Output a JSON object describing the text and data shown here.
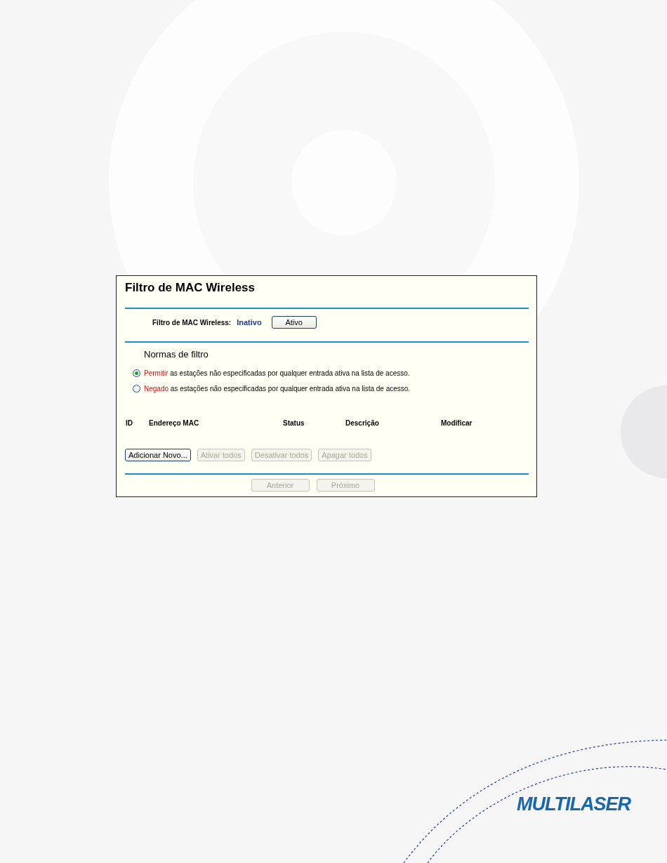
{
  "panel": {
    "title": "Filtro de MAC Wireless",
    "status": {
      "label": "Filtro de MAC Wireless:",
      "value": "Inativo",
      "button": "Ativo"
    },
    "rules": {
      "heading": "Normas de filtro",
      "options": [
        {
          "keyword": "Permitir",
          "text": "as estações não especificadas por qualquer entrada ativa na lista de acesso.",
          "selected": true
        },
        {
          "keyword": "Negado",
          "text": "as estações não especificadas por qualquer entrada ativa na lista de acesso.",
          "selected": false
        }
      ]
    },
    "table": {
      "columns": [
        "ID",
        "Endereço MAC",
        "Status",
        "Descrição",
        "Modificar"
      ]
    },
    "actions": [
      {
        "label": "Adicionar Novo...",
        "disabled": false
      },
      {
        "label": "Ativar todos",
        "disabled": true
      },
      {
        "label": "Desativar todos",
        "disabled": true
      },
      {
        "label": "Apagar todos",
        "disabled": true
      }
    ],
    "nav": [
      {
        "label": "Anterior",
        "disabled": true
      },
      {
        "label": "Próximo",
        "disabled": true
      }
    ]
  },
  "logo": "MULTILASER"
}
